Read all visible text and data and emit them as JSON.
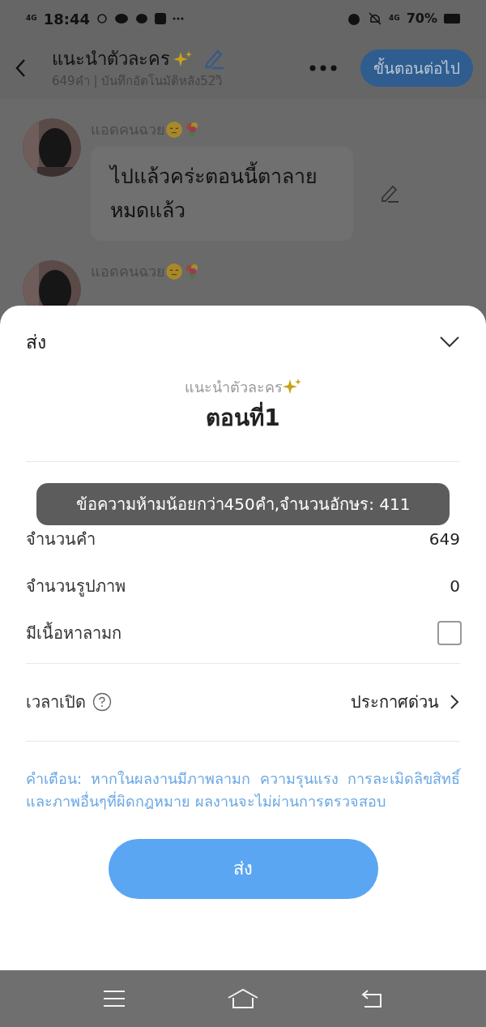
{
  "status_bar": {
    "network_left": "4G",
    "time": "18:44",
    "network_right": "4G",
    "battery": "70%"
  },
  "header": {
    "title": "แนะนำตัวละคร",
    "subtitle": "649คำ | บันทึกอัตโนมัติหลัง52วิ",
    "next_button": "ขั้นตอนต่อไป"
  },
  "messages": [
    {
      "sender": "แอดคนฉวย",
      "text": "ไปแล้วคร่ะตอนนี้ตาลายหมดแล้ว"
    },
    {
      "sender": "แอดคนฉวย"
    }
  ],
  "sheet": {
    "title": "ส่ง",
    "work_title": "แนะนำตัวละคร",
    "chapter": "ตอนที่1",
    "rows": [
      {
        "kind": "value",
        "label": "จำนวนคำ",
        "value": "649"
      },
      {
        "kind": "value",
        "label": "จำนวนรูปภาพ",
        "value": "0"
      },
      {
        "kind": "checkbox",
        "label": "มีเนื้อหาลามก",
        "checked": false
      }
    ],
    "publish": {
      "label": "เวลาเปิด",
      "value": "ประกาศด่วน"
    },
    "warning": "คำเตือน: หากในผลงานมีภาพลามก ความรุนแรง การละเมิดลิขสิทธิ์และภาพอื่นๆที่ผิดกฎหมาย ผลงานจะไม่ผ่านการตรวจสอบ",
    "submit": "ส่ง"
  },
  "toast": "ข้อความห้ามน้อยกว่า450คำ,จำนวนอักษร: 411"
}
